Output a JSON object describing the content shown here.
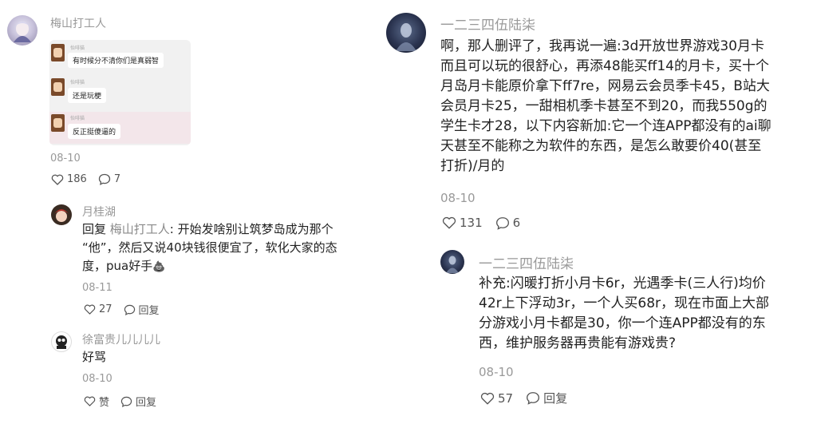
{
  "left_thread": {
    "main_comment": {
      "author": "梅山打工人",
      "image_chat": [
        {
          "name": "怡啡猫",
          "text": "有时候分不清你们是真弱智"
        },
        {
          "name": "怡啡猫",
          "text": "还是玩梗"
        },
        {
          "name": "怡啡猫",
          "text": "反正挺傻逼的"
        }
      ],
      "date": "08-10",
      "likes": "186",
      "comments": "7"
    },
    "replies": [
      {
        "author": "月桂湖",
        "reply_prefix": "回复 ",
        "mention": "梅山打工人",
        "lines": [
          ": 开始发啥别让筑梦岛成为那个",
          "“他”，然后又说40块钱很便宜了，软化大家的态",
          "度，pua好手"
        ],
        "emoji": "💩",
        "date": "08-11",
        "likes": "27",
        "reply_label": "回复"
      },
      {
        "author": "徐富贵儿儿儿儿",
        "text": "好骂",
        "date": "08-10",
        "like_label": "赞",
        "reply_label": "回复"
      }
    ]
  },
  "right_thread": {
    "main_comment": {
      "author": "一二三四伍陆柒",
      "lines": [
        "啊，那人删评了，我再说一遍:3d开放世界游戏30月卡",
        "而且可以玩的很舒心，再添48能买ff14的月卡，买十个",
        "月岛月卡能原价拿下ff7re，网易云会员季卡45，B站大",
        "会员月卡25，一甜相机季卡甚至不到20，而我550g的",
        "学生卡才28，以下内容新加:它一个连APP都没有的ai聊",
        "天甚至不能称之为软件的东西，是怎么敢要价40(甚至",
        "打折)/月的"
      ],
      "date": "08-10",
      "likes": "131",
      "comments": "6"
    },
    "reply": {
      "author": "一二三四伍陆柒",
      "lines": [
        "补充:闪暖打折小月卡6r，光遇季卡(三人行)均价",
        "42r上下浮动3r，一个人买68r，现在市面上大部",
        "分游戏小月卡都是30，你一个连APP都没有的东",
        "西，维护服务器再贵能有游戏贵?"
      ],
      "date": "08-10",
      "likes": "57",
      "reply_label": "回复"
    }
  }
}
